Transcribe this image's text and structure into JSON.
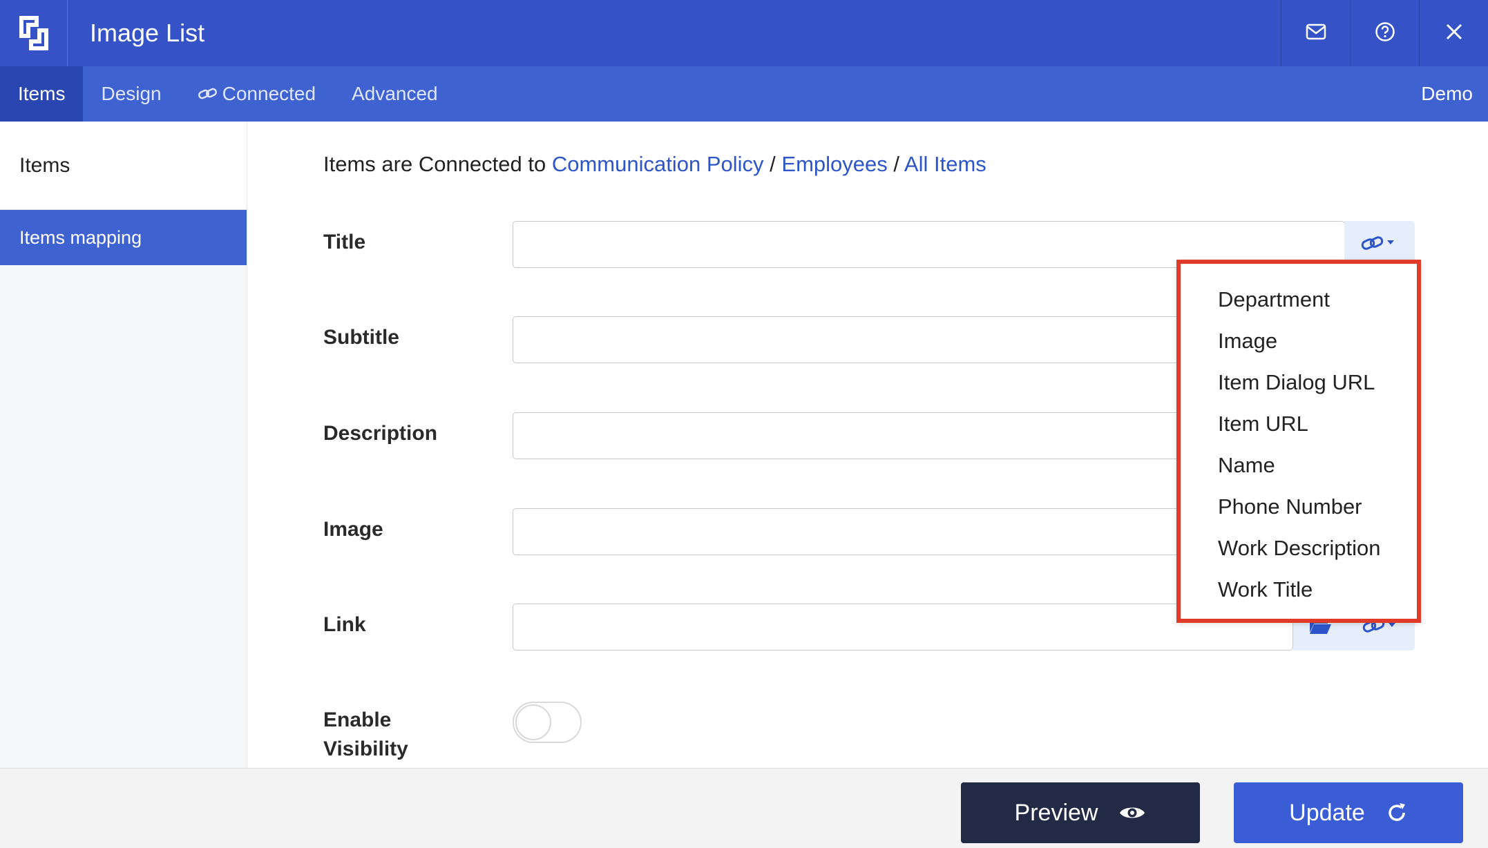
{
  "app": {
    "title": "Image List"
  },
  "window_buttons": {
    "mail": "mail-icon",
    "help": "help-icon",
    "close": "close-icon"
  },
  "tabs": [
    {
      "label": "Items",
      "active": true
    },
    {
      "label": "Design",
      "active": false
    },
    {
      "label": "Connected",
      "active": false,
      "icon": "link-icon"
    },
    {
      "label": "Advanced",
      "active": false
    }
  ],
  "user": {
    "label": "Demo"
  },
  "sidebar": {
    "items": [
      {
        "label": "Items"
      },
      {
        "label": "Items mapping",
        "active": true
      }
    ]
  },
  "breadcrumb": {
    "prefix": "Items are Connected to",
    "sep": "/",
    "parts": [
      "Communication Policy",
      "Employees",
      "All Items"
    ]
  },
  "fields": {
    "title": {
      "label": "Title",
      "value": ""
    },
    "subtitle": {
      "label": "Subtitle",
      "value": ""
    },
    "description": {
      "label": "Description",
      "value": ""
    },
    "image": {
      "label": "Image",
      "value": ""
    },
    "link": {
      "label": "Link",
      "value": ""
    },
    "enable_visibility": {
      "label_line1": "Enable",
      "label_line2": "Visibility",
      "on": false
    }
  },
  "dropdown": {
    "options": [
      "Department",
      "Image",
      "Item Dialog URL",
      "Item URL",
      "Name",
      "Phone Number",
      "Work Description",
      "Work Title"
    ]
  },
  "footer": {
    "preview_label": "Preview",
    "update_label": "Update"
  },
  "colors": {
    "titlebar": "#3553c7",
    "tabbar": "#3f62d1",
    "accent": "#3a5dd6",
    "link": "#2c55c9",
    "highlight_border": "#e03a28",
    "preview_btn": "#222a45"
  }
}
